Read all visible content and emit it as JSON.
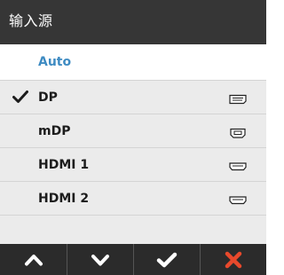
{
  "header": {
    "title": "输入源"
  },
  "colors": {
    "header_bg": "#363636",
    "row_bg": "#ebebeb",
    "highlight_text": "#3e8bc2",
    "close_red": "#e8492c",
    "footer_bg": "#2b2b2b"
  },
  "menu": {
    "items": [
      {
        "label": "Auto",
        "highlighted": true,
        "selected": false,
        "port_icon": ""
      },
      {
        "label": "DP",
        "highlighted": false,
        "selected": true,
        "port_icon": "displayport-icon"
      },
      {
        "label": "mDP",
        "highlighted": false,
        "selected": false,
        "port_icon": "mini-displayport-icon"
      },
      {
        "label": "HDMI 1",
        "highlighted": false,
        "selected": false,
        "port_icon": "hdmi-icon"
      },
      {
        "label": "HDMI 2",
        "highlighted": false,
        "selected": false,
        "port_icon": "hdmi-icon"
      }
    ]
  },
  "footer": {
    "buttons": [
      {
        "icon": "chevron-up-icon"
      },
      {
        "icon": "chevron-down-icon"
      },
      {
        "icon": "checkmark-icon"
      },
      {
        "icon": "close-icon"
      }
    ]
  }
}
